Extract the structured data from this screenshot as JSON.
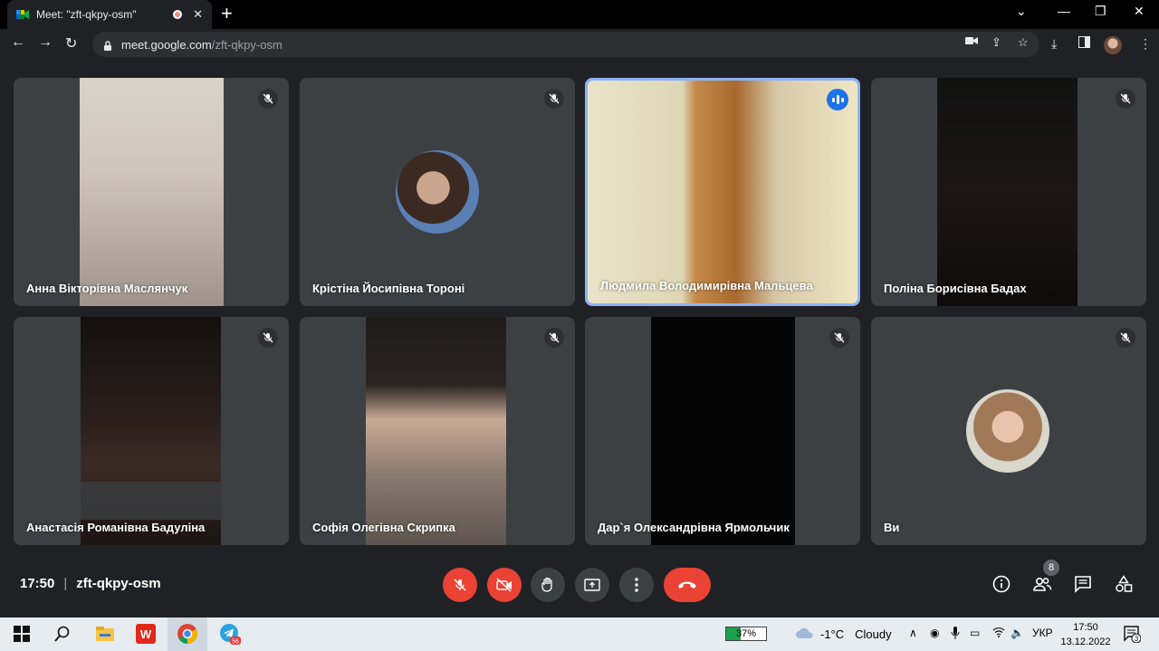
{
  "browser": {
    "tab_title": "Meet: \"zft-qkpy-osm\"",
    "url_domain": "meet.google.com",
    "url_path": "/zft-qkpy-osm"
  },
  "participants": [
    {
      "name": "Анна Вікторівна Маслянчук"
    },
    {
      "name": "Крістіна Йосипівна Тороні"
    },
    {
      "name": "Людмила Володимирівна Мальцева"
    },
    {
      "name": "Поліна Борисівна Бадах"
    },
    {
      "name": "Анастасія Романівна Бадуліна"
    },
    {
      "name": "Софія Олегівна Скрипка"
    },
    {
      "name": "Дар`я Олександрівна Ярмольчик"
    },
    {
      "name": "Ви"
    }
  ],
  "meeting": {
    "time": "17:50",
    "code": "zft-qkpy-osm",
    "people_count": "8"
  },
  "taskbar": {
    "telegram_badge": "56",
    "battery": "37%",
    "temperature": "-1°C",
    "weather": "Cloudy",
    "language": "УКР",
    "clock_time": "17:50",
    "clock_date": "13.12.2022",
    "notifications": "3"
  },
  "colors": {
    "speaking_border": "#8ab4f8",
    "end_call": "#ea4335",
    "tile_bg": "#3c4043"
  }
}
